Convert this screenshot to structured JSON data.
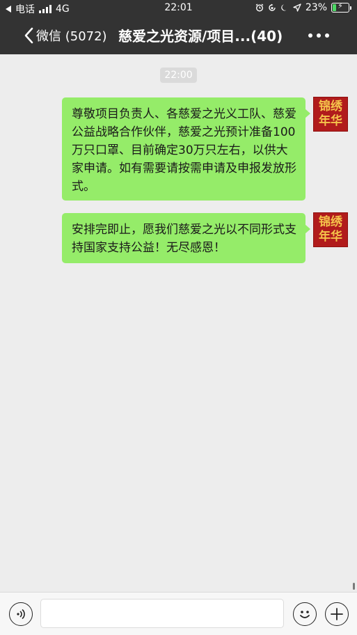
{
  "status_bar": {
    "carrier": "电话",
    "network": "4G",
    "time": "22:01",
    "battery_percent": "23%",
    "battery_level": 0.23
  },
  "nav": {
    "back_label": "微信 (5072)",
    "title": "慈爱之光资源/项目...(40)"
  },
  "chat": {
    "timestamp": "22:00",
    "messages": [
      {
        "text": "尊敬项目负责人、各慈爱之光义工队、慈爱公益战略合作伙伴，慈爱之光预计准备100万只口罩、目前确定30万只左右，以供大家申请。如有需要请按需申请及申报发放形式。",
        "avatar_line1": "锦绣",
        "avatar_line2": "年华"
      },
      {
        "text": "安排完即止，愿我们慈爱之光以不同形式支持国家支持公益！无尽感恩！",
        "avatar_line1": "锦绣",
        "avatar_line2": "年华"
      }
    ]
  },
  "input_bar": {
    "value": "",
    "placeholder": ""
  },
  "colors": {
    "header_bg": "#333333",
    "chat_bg": "#ededed",
    "bubble_green": "#95ec69",
    "avatar_red": "#b11c1c",
    "avatar_gold": "#f5c44b"
  },
  "icons": {
    "back_to_app": "back-triangle-icon",
    "signal": "signal-bars-icon",
    "alarm": "alarm-clock-icon",
    "rotation_lock": "rotation-lock-icon",
    "do_not_disturb": "moon-icon",
    "location": "location-arrow-icon",
    "battery": "battery-charging-icon",
    "back": "chevron-left-icon",
    "more": "more-dots-icon",
    "voice": "voice-icon",
    "emoji": "emoji-icon",
    "add": "plus-icon"
  }
}
